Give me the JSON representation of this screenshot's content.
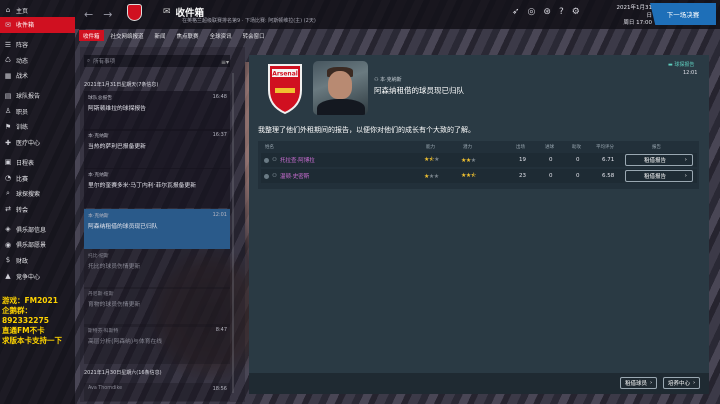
{
  "sidebar": {
    "items": [
      {
        "label": "主页",
        "icon": "home-icon"
      },
      {
        "label": "收件箱",
        "icon": "mail-icon",
        "active": true
      },
      {
        "label": "阵容",
        "icon": "squad-icon"
      },
      {
        "label": "动态",
        "icon": "dynamics-icon"
      },
      {
        "label": "战术",
        "icon": "tactics-icon"
      },
      {
        "label": "球队报告",
        "icon": "report-icon"
      },
      {
        "label": "职员",
        "icon": "staff-icon"
      },
      {
        "label": "训练",
        "icon": "training-icon"
      },
      {
        "label": "医疗中心",
        "icon": "medical-icon"
      },
      {
        "label": "日程表",
        "icon": "calendar-icon"
      },
      {
        "label": "比赛",
        "icon": "competition-icon"
      },
      {
        "label": "球探搜索",
        "icon": "scouting-icon"
      },
      {
        "label": "转会",
        "icon": "transfers-icon"
      },
      {
        "label": "俱乐部信息",
        "icon": "club-info-icon"
      },
      {
        "label": "俱乐部愿景",
        "icon": "club-vision-icon"
      },
      {
        "label": "财政",
        "icon": "finances-icon"
      },
      {
        "label": "竞争中心",
        "icon": "competition-centre-icon"
      }
    ],
    "promo": [
      "游戏：FM2021",
      "企鹅群：892332275",
      "直通FM不卡",
      "求版本卡支持一下"
    ]
  },
  "header": {
    "title": "收件箱",
    "subtitle": "在英格兰超级联赛排名第9 · 下场比赛: 阿斯顿维拉(主) (2天)",
    "date_line1": "2021年1月31日",
    "date_line2": "周日 17:00",
    "continue": "下一场决赛"
  },
  "tabs": [
    "收件箱",
    "社交网络报道",
    "新闻",
    "焦点联赛",
    "全球资讯",
    "转会窗口"
  ],
  "inbox": {
    "search_placeholder": "所有事项",
    "groups": [
      {
        "date": "2021年1月31日星期天(7条信息)"
      },
      {
        "date": "2021年1月30日星期六(16条信息)"
      }
    ],
    "messages": [
      {
        "sender": "球队总报告",
        "time": "16:48",
        "subject": "阿斯顿维拉的球探报告"
      },
      {
        "sender": "本·克纳斯",
        "time": "16:37",
        "subject": "当热的萨利巴报备更新"
      },
      {
        "sender": "本·克纳斯",
        "time": "",
        "subject": "里尔的奎赛多米·马丁内利·菲尔瓦报备更新"
      },
      {
        "sender": "本·克纳斯",
        "time": "12:01",
        "subject": "阿森纳租借的球员现已归队"
      },
      {
        "sender": "托比·纽斯",
        "time": "",
        "subject": "托比的球员伤情更新"
      },
      {
        "sender": "丹尼斯·纽斯",
        "time": "",
        "subject": "育物的球员伤情更新"
      },
      {
        "sender": "斯特芬·科斯特",
        "time": "8:47",
        "subject": "高层分析(阿森纳)与体育在线"
      },
      {
        "sender": "Ava Thorndike",
        "time": "18:56",
        "subject": ""
      }
    ]
  },
  "message": {
    "crest_text": "Arsenal",
    "from": "本·克纳斯",
    "subject": "阿森纳租借的球员现已归队",
    "tag": "球探报告",
    "time": "12:01",
    "body": "我整理了他们外租期间的报告，以便你对他们的成长有个大致的了解。",
    "columns": [
      "姓名",
      "能力",
      "潜力",
      "出场",
      "进球",
      "助攻",
      "平均评分",
      "报告"
    ],
    "rows": [
      {
        "name": "托拉查·阿博拉",
        "ability": 1.5,
        "potential": 2,
        "apps": "19",
        "goals": "0",
        "assists": "0",
        "rating": "6.71",
        "btn": "租借报告"
      },
      {
        "name": "温顿·史密斯",
        "ability": 1,
        "potential": 2.5,
        "apps": "23",
        "goals": "0",
        "assists": "0",
        "rating": "6.58",
        "btn": "租借报告"
      }
    ],
    "footer_buttons": [
      "租借球员",
      "培养中心"
    ]
  }
}
